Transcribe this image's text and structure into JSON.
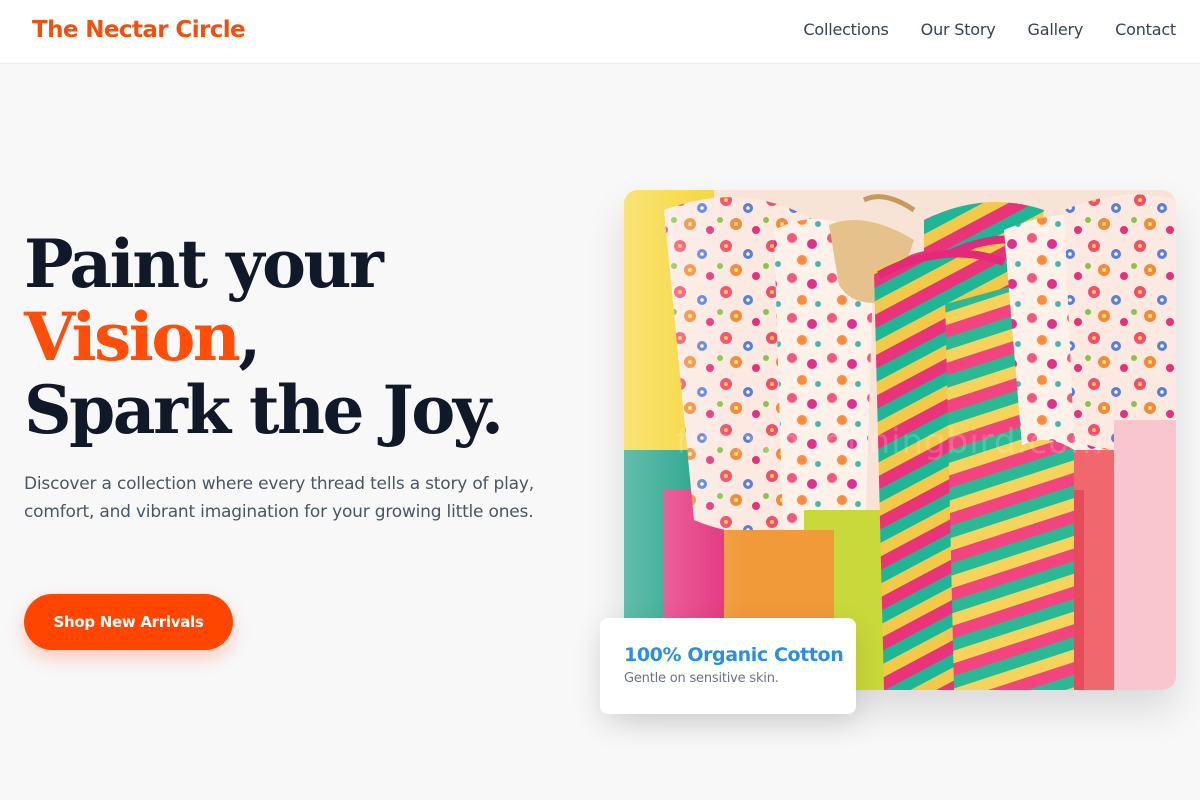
{
  "nav": {
    "brand": "The Nectar Circle",
    "links": [
      "Collections",
      "Our Story",
      "Gallery",
      "Contact"
    ]
  },
  "hero": {
    "title_line1": "Paint your",
    "title_accent": "Vision",
    "title_comma": ",",
    "title_line3": "Spark the Joy.",
    "description": "Discover a collection where every thread tells a story of play, comfort, and vibrant imagination for your growing little ones.",
    "cta_label": "Shop New Arrivals"
  },
  "photo": {
    "subject": "colorful children's clothing on hangers",
    "watermark": "funnyhummingbird.com"
  },
  "badge": {
    "title": "100% Organic Cotton",
    "subtitle": "Gentle on sensitive skin."
  },
  "colors": {
    "brand": "#f1500f",
    "accent": "#ff4d0a",
    "cta": "#ff4500",
    "badge_title": "#2a8fe0",
    "heading": "#111827",
    "body_text": "#4b5563"
  }
}
